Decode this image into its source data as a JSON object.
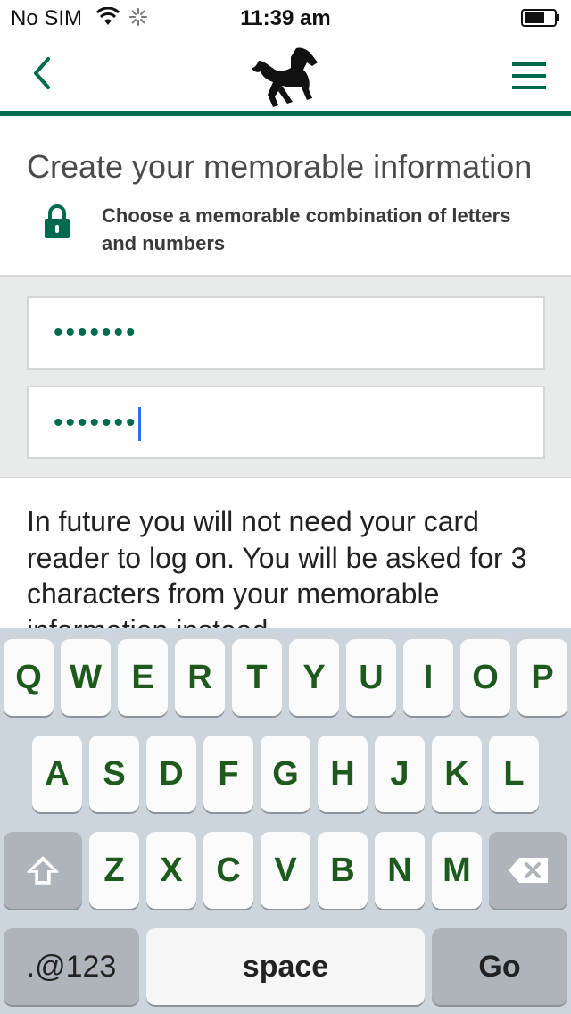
{
  "status_bar": {
    "carrier": "No SIM",
    "time": "11:39 am"
  },
  "header": {
    "back_icon": "chevron-left-icon",
    "logo_icon": "black-horse-logo",
    "menu_icon": "hamburger-menu-icon",
    "accent_color": "#006a4d"
  },
  "page": {
    "title": "Create your memorable information",
    "subtitle": "Choose a memorable combination of letters and numbers",
    "field1_value": "•••••••",
    "field2_value": "•••••••",
    "info_text": "In future you will not need your card reader to log on. You will be asked for 3 characters from your memorable information instead."
  },
  "keyboard": {
    "row1": [
      "Q",
      "W",
      "E",
      "R",
      "T",
      "Y",
      "U",
      "I",
      "O",
      "P"
    ],
    "row2": [
      "A",
      "S",
      "D",
      "F",
      "G",
      "H",
      "J",
      "K",
      "L"
    ],
    "row3": [
      "Z",
      "X",
      "C",
      "V",
      "B",
      "N",
      "M"
    ],
    "shift_icon": "shift-arrow-icon",
    "delete_icon": "backspace-icon",
    "numbers_label": ".@123",
    "space_label": "space",
    "go_label": "Go"
  }
}
